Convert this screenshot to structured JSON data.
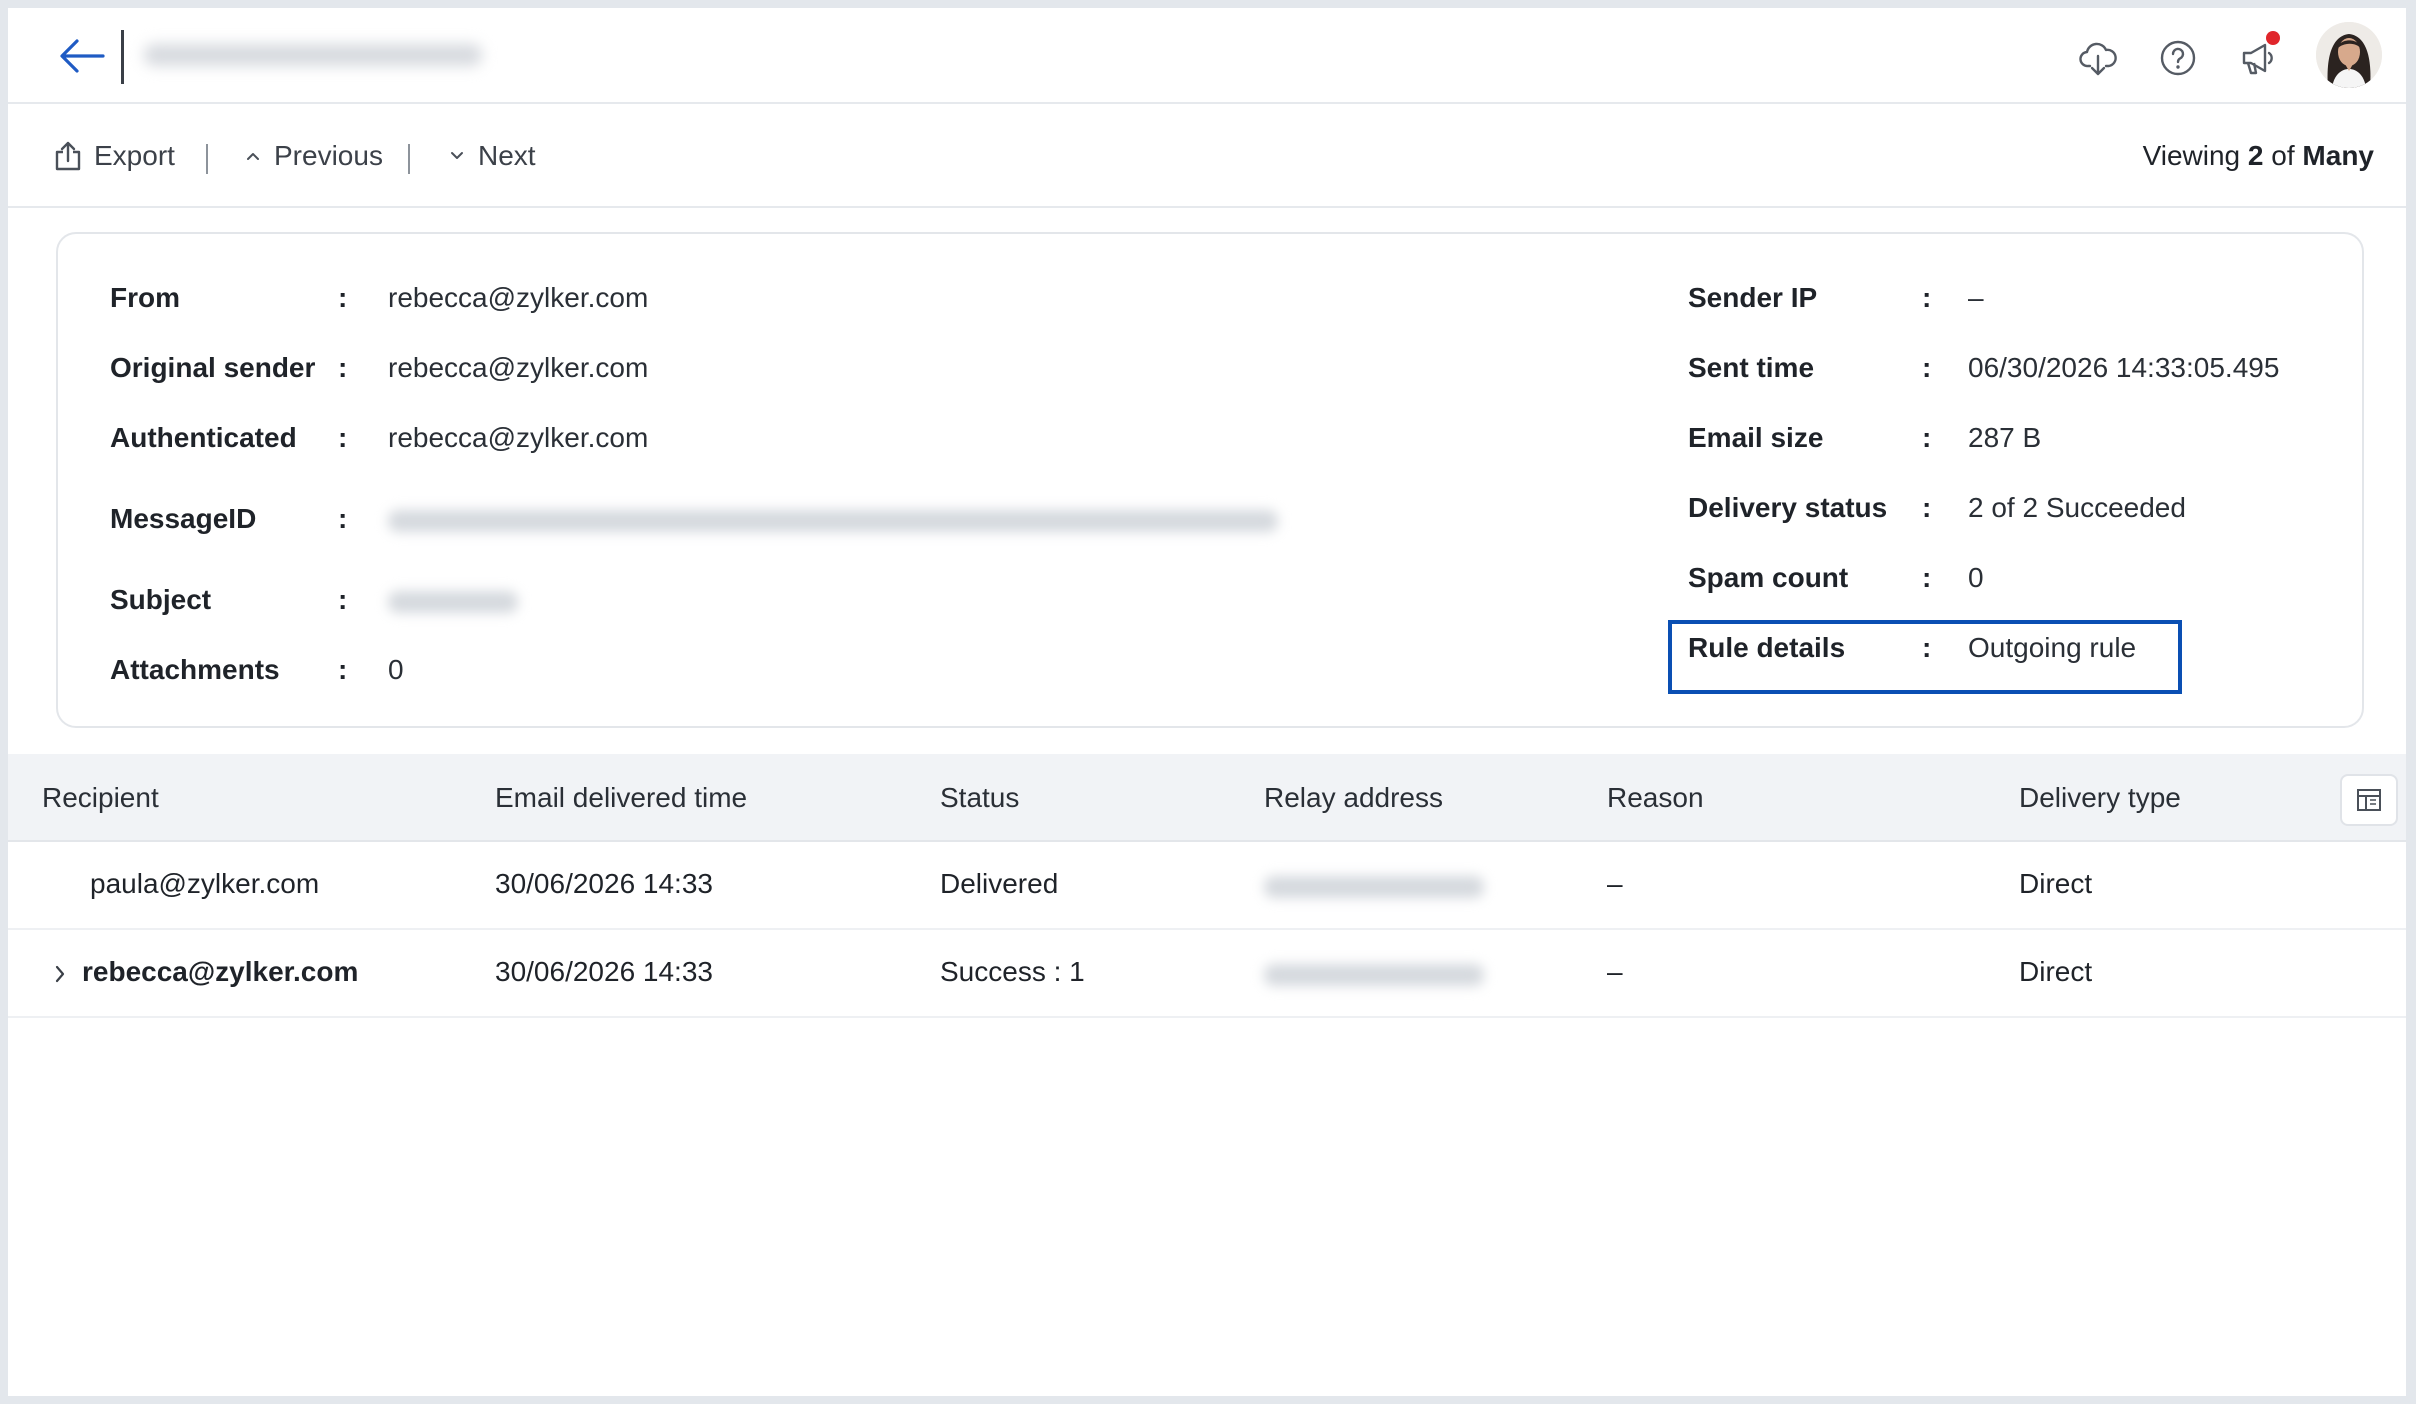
{
  "header": {
    "back_icon": "arrow-left-icon",
    "icons": [
      "cloud-download-icon",
      "help-icon",
      "announcement-icon"
    ],
    "notification_dot_color": "#e0262b"
  },
  "toolbar": {
    "export_label": "Export",
    "previous_label": "Previous",
    "next_label": "Next",
    "viewing_prefix": "Viewing",
    "viewing_current": "2",
    "viewing_of": "of",
    "viewing_total": "Many"
  },
  "details": {
    "left": [
      {
        "label": "From",
        "value": "rebecca@zylker.com"
      },
      {
        "label": "Original sender",
        "value": "rebecca@zylker.com"
      },
      {
        "label": "Authenticated",
        "value": "rebecca@zylker.com"
      },
      {
        "label": "MessageID",
        "value": ""
      },
      {
        "label": "Subject",
        "value": ""
      },
      {
        "label": "Attachments",
        "value": "0"
      }
    ],
    "right": [
      {
        "label": "Sender IP",
        "value": "–"
      },
      {
        "label": "Sent time",
        "value": "06/30/2026 14:33:05.495"
      },
      {
        "label": "Email size",
        "value": "287 B"
      },
      {
        "label": "Delivery status",
        "value": "2 of 2 Succeeded"
      },
      {
        "label": "Spam count",
        "value": "0"
      },
      {
        "label": "Rule details",
        "value": "Outgoing rule"
      }
    ],
    "separator": ":",
    "highlight_color": "#0a4fb3"
  },
  "table": {
    "columns": [
      "Recipient",
      "Email delivered time",
      "Status",
      "Relay address",
      "Reason",
      "Delivery type"
    ],
    "rows": [
      {
        "recipient": "paula@zylker.com",
        "delivered_time": "30/06/2026 14:33",
        "status": "Delivered",
        "reason": "–",
        "delivery_type": "Direct"
      },
      {
        "recipient": "rebecca@zylker.com",
        "delivered_time": "30/06/2026 14:33",
        "status": "Success : 1",
        "reason": "–",
        "delivery_type": "Direct"
      }
    ]
  }
}
